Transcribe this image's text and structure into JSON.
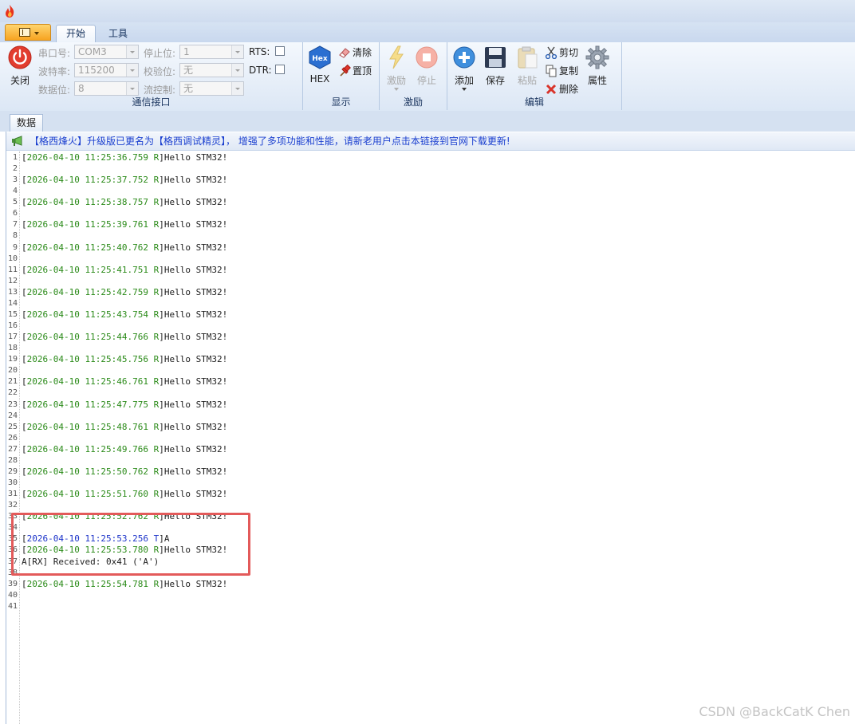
{
  "colors": {
    "rx": "#2a8a18",
    "tx": "#1c33c9",
    "highlight": "#e35a5a",
    "notice_text": "#1a3fcf"
  },
  "tabs": [
    {
      "label": "开始",
      "active": true
    },
    {
      "label": "工具",
      "active": false
    }
  ],
  "ribbon": {
    "close_button": {
      "label": "关闭",
      "icon": "power-icon"
    },
    "port": {
      "label": "串口号:",
      "value": "COM3"
    },
    "baud": {
      "label": "波特率:",
      "value": "115200"
    },
    "databits": {
      "label": "数据位:",
      "value": "8"
    },
    "stopbits": {
      "label": "停止位:",
      "value": "1"
    },
    "parity": {
      "label": "校验位:",
      "value": "无"
    },
    "flow": {
      "label": "流控制:",
      "value": "无"
    },
    "rts": {
      "label": "RTS:",
      "checked": false
    },
    "dtr": {
      "label": "DTR:",
      "checked": false
    },
    "comm_group": "通信接口",
    "hex_button": {
      "label": "HEX",
      "badge": "Hex",
      "icon": "hex-icon"
    },
    "clear_button": {
      "label": "清除",
      "icon": "eraser-icon"
    },
    "top_button": {
      "label": "置顶",
      "icon": "pin-icon"
    },
    "display_group": "显示",
    "trigger_button": {
      "label": "激励",
      "icon": "lightning-icon"
    },
    "stop_button": {
      "label": "停止",
      "icon": "stop-icon"
    },
    "trigger_group": "激励",
    "add_button": {
      "label": "添加",
      "icon": "plus-icon"
    },
    "save_button": {
      "label": "保存",
      "icon": "floppy-icon"
    },
    "paste_button": {
      "label": "粘贴",
      "icon": "clipboard-icon"
    },
    "cut_button": {
      "label": "剪切",
      "icon": "scissors-icon"
    },
    "copy_button": {
      "label": "复制",
      "icon": "copy-icon"
    },
    "delete_button": {
      "label": "删除",
      "icon": "delete-icon"
    },
    "properties_button": {
      "label": "属性",
      "icon": "gear-icon"
    },
    "edit_group": "编辑"
  },
  "doc_tab": "数据",
  "notice": "【格西烽火】升级版已更名为【格西调试精灵】， 增强了多项功能和性能，请新老用户点击本链接到官网下载更新!",
  "log": [
    {
      "n": "1",
      "ts": "[2026-04-10 11:25:36.759 R]",
      "dir": "rx",
      "msg": "Hello STM32!"
    },
    {
      "n": "2",
      "ts": "",
      "dir": "",
      "msg": ""
    },
    {
      "n": "3",
      "ts": "[2026-04-10 11:25:37.752 R]",
      "dir": "rx",
      "msg": "Hello STM32!"
    },
    {
      "n": "4",
      "ts": "",
      "dir": "",
      "msg": ""
    },
    {
      "n": "5",
      "ts": "[2026-04-10 11:25:38.757 R]",
      "dir": "rx",
      "msg": "Hello STM32!"
    },
    {
      "n": "6",
      "ts": "",
      "dir": "",
      "msg": ""
    },
    {
      "n": "7",
      "ts": "[2026-04-10 11:25:39.761 R]",
      "dir": "rx",
      "msg": "Hello STM32!"
    },
    {
      "n": "8",
      "ts": "",
      "dir": "",
      "msg": ""
    },
    {
      "n": "9",
      "ts": "[2026-04-10 11:25:40.762 R]",
      "dir": "rx",
      "msg": "Hello STM32!"
    },
    {
      "n": "10",
      "ts": "",
      "dir": "",
      "msg": ""
    },
    {
      "n": "11",
      "ts": "[2026-04-10 11:25:41.751 R]",
      "dir": "rx",
      "msg": "Hello STM32!"
    },
    {
      "n": "12",
      "ts": "",
      "dir": "",
      "msg": ""
    },
    {
      "n": "13",
      "ts": "[2026-04-10 11:25:42.759 R]",
      "dir": "rx",
      "msg": "Hello STM32!"
    },
    {
      "n": "14",
      "ts": "",
      "dir": "",
      "msg": ""
    },
    {
      "n": "15",
      "ts": "[2026-04-10 11:25:43.754 R]",
      "dir": "rx",
      "msg": "Hello STM32!"
    },
    {
      "n": "16",
      "ts": "",
      "dir": "",
      "msg": ""
    },
    {
      "n": "17",
      "ts": "[2026-04-10 11:25:44.766 R]",
      "dir": "rx",
      "msg": "Hello STM32!"
    },
    {
      "n": "18",
      "ts": "",
      "dir": "",
      "msg": ""
    },
    {
      "n": "19",
      "ts": "[2026-04-10 11:25:45.756 R]",
      "dir": "rx",
      "msg": "Hello STM32!"
    },
    {
      "n": "20",
      "ts": "",
      "dir": "",
      "msg": ""
    },
    {
      "n": "21",
      "ts": "[2026-04-10 11:25:46.761 R]",
      "dir": "rx",
      "msg": "Hello STM32!"
    },
    {
      "n": "22",
      "ts": "",
      "dir": "",
      "msg": ""
    },
    {
      "n": "23",
      "ts": "[2026-04-10 11:25:47.775 R]",
      "dir": "rx",
      "msg": "Hello STM32!"
    },
    {
      "n": "24",
      "ts": "",
      "dir": "",
      "msg": ""
    },
    {
      "n": "25",
      "ts": "[2026-04-10 11:25:48.761 R]",
      "dir": "rx",
      "msg": "Hello STM32!"
    },
    {
      "n": "26",
      "ts": "",
      "dir": "",
      "msg": ""
    },
    {
      "n": "27",
      "ts": "[2026-04-10 11:25:49.766 R]",
      "dir": "rx",
      "msg": "Hello STM32!"
    },
    {
      "n": "28",
      "ts": "",
      "dir": "",
      "msg": ""
    },
    {
      "n": "29",
      "ts": "[2026-04-10 11:25:50.762 R]",
      "dir": "rx",
      "msg": "Hello STM32!"
    },
    {
      "n": "30",
      "ts": "",
      "dir": "",
      "msg": ""
    },
    {
      "n": "31",
      "ts": "[2026-04-10 11:25:51.760 R]",
      "dir": "rx",
      "msg": "Hello STM32!"
    },
    {
      "n": "32",
      "ts": "",
      "dir": "",
      "msg": ""
    },
    {
      "n": "33",
      "ts": "[2026-04-10 11:25:52.762 R]",
      "dir": "rx",
      "msg": "Hello STM32!"
    },
    {
      "n": "34",
      "ts": "",
      "dir": "",
      "msg": ""
    },
    {
      "n": "35",
      "ts": "[2026-04-10 11:25:53.256 T]",
      "dir": "tx",
      "msg": "A"
    },
    {
      "n": "36",
      "ts": "[2026-04-10 11:25:53.780 R]",
      "dir": "rx",
      "msg": "Hello STM32!"
    },
    {
      "n": "37",
      "ts": "",
      "dir": "",
      "msg": "A[RX] Received: 0x41 ('A')"
    },
    {
      "n": "38",
      "ts": "",
      "dir": "",
      "msg": ""
    },
    {
      "n": "39",
      "ts": "[2026-04-10 11:25:54.781 R]",
      "dir": "rx",
      "msg": "Hello STM32!"
    },
    {
      "n": "40",
      "ts": "",
      "dir": "",
      "msg": ""
    },
    {
      "n": "41",
      "ts": "",
      "dir": "",
      "msg": ""
    }
  ],
  "watermark": "CSDN @BackCatK Chen"
}
